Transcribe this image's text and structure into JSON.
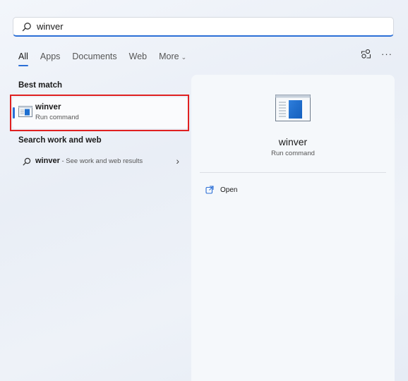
{
  "search": {
    "value": "winver",
    "icon": "search-icon"
  },
  "tabs": [
    {
      "label": "All",
      "active": true
    },
    {
      "label": "Apps"
    },
    {
      "label": "Documents"
    },
    {
      "label": "Web"
    },
    {
      "label": "More"
    }
  ],
  "toolbar": {
    "dots": "···"
  },
  "best_match": {
    "heading": "Best match",
    "title": "winver",
    "subtitle": "Run command"
  },
  "web_section": {
    "heading": "Search work and web",
    "term": "winver",
    "hint": " - See work and web results",
    "arrow": "›"
  },
  "preview": {
    "title": "winver",
    "subtitle": "Run command",
    "action_label": "Open"
  },
  "colors": {
    "accent": "#2b6fd6",
    "highlight": "#e02020"
  }
}
